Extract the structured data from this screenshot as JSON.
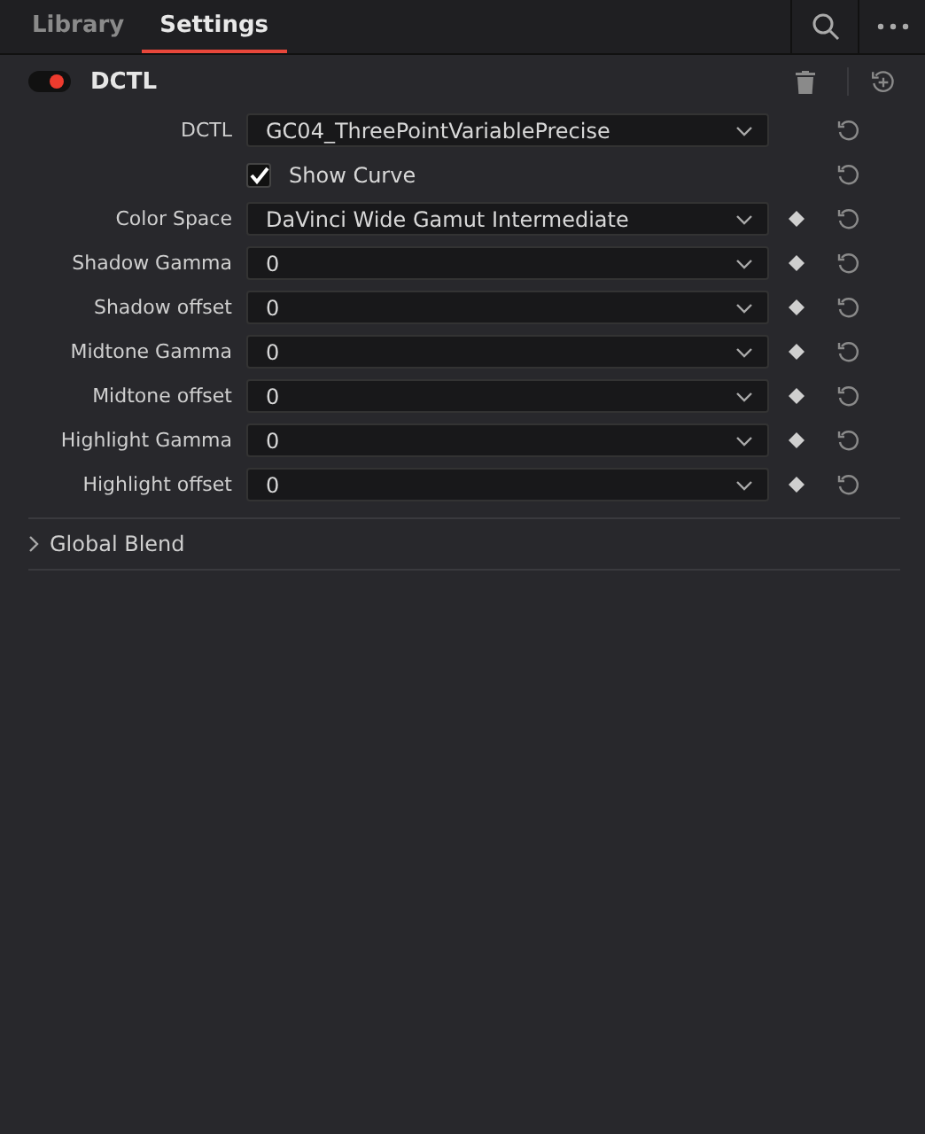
{
  "tabs": [
    {
      "label": "Library",
      "selected": false
    },
    {
      "label": "Settings",
      "selected": true
    }
  ],
  "effect": {
    "title": "DCTL",
    "on": true
  },
  "params": [
    {
      "kind": "dropdown",
      "label": "DCTL",
      "value": "GC04_ThreePointVariablePrecise",
      "keyframe": false
    },
    {
      "kind": "checkbox",
      "label": "Show Curve",
      "checked": true,
      "keyframe": false
    },
    {
      "kind": "dropdown",
      "label": "Color Space",
      "value": "DaVinci Wide Gamut Intermediate",
      "keyframe": true
    },
    {
      "kind": "dropdown",
      "label": "Shadow Gamma",
      "value": "0",
      "keyframe": true
    },
    {
      "kind": "dropdown",
      "label": "Shadow offset",
      "value": "0",
      "keyframe": true
    },
    {
      "kind": "dropdown",
      "label": "Midtone Gamma",
      "value": "0",
      "keyframe": true
    },
    {
      "kind": "dropdown",
      "label": "Midtone offset",
      "value": "0",
      "keyframe": true
    },
    {
      "kind": "dropdown",
      "label": "Highlight Gamma",
      "value": "0",
      "keyframe": true
    },
    {
      "kind": "dropdown",
      "label": "Highlight offset",
      "value": "0",
      "keyframe": true
    }
  ],
  "sections": [
    {
      "title": "Global Blend",
      "expanded": false
    }
  ]
}
